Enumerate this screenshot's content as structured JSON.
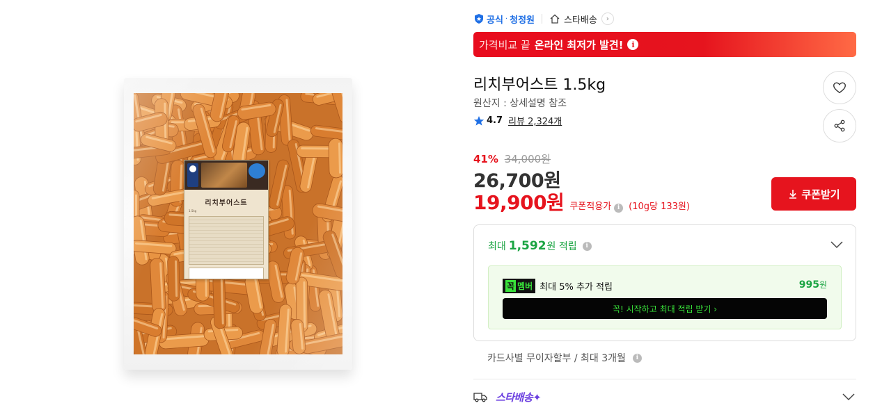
{
  "product_image": {
    "label_title": "리치부어스트",
    "label_sub": "1.5kg"
  },
  "brand": {
    "official": "공식",
    "separator": "·",
    "name": "청정원",
    "delivery": "스타배송"
  },
  "promo": {
    "light_text": "가격비교 끝",
    "bold_text": "온라인 최저가 발견!",
    "info": "i"
  },
  "product": {
    "title": "리치부어스트 1.5kg",
    "origin": "원산지 : 상세설명 참조",
    "rating": "4.7",
    "review_label": "리뷰 2,324개"
  },
  "price": {
    "discount_rate": "41%",
    "original": "34,000원",
    "sale": "26,700원",
    "coupon": "19,900원",
    "coupon_applied": "쿠폰적용가",
    "unit": "(10g당 133원)",
    "info": "i"
  },
  "coupon_button": {
    "label": "쿠폰받기"
  },
  "reward": {
    "max_label": "최대",
    "amount": "1,592",
    "unit": "원 적립",
    "info": "i",
    "member_badge_a": "꼭",
    "member_badge_b": "멤버",
    "member_text": "최대 5% 추가 적립",
    "member_amount": "995",
    "member_amount_unit": "원",
    "member_cta": "꼭! 시작하고 최대 적립 받기  ›"
  },
  "card": {
    "text": "카드사별 무이자할부 / 최대 3개월",
    "info": "i"
  },
  "delivery": {
    "logo": "스타배송✦"
  },
  "colors": {
    "accent_red": "#e6141e",
    "brand_blue": "#1f6fe5",
    "reward_green": "#1aa442",
    "member_green": "#39e23a",
    "star_purple": "#6b3fe0"
  }
}
